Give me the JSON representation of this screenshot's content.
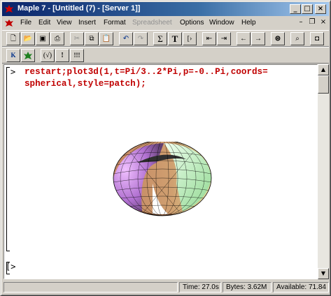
{
  "window": {
    "title": "Maple 7 - [Untitled (7) - [Server 1]]"
  },
  "menu": [
    {
      "label": "File",
      "disabled": false
    },
    {
      "label": "Edit",
      "disabled": false
    },
    {
      "label": "View",
      "disabled": false
    },
    {
      "label": "Insert",
      "disabled": false
    },
    {
      "label": "Format",
      "disabled": false
    },
    {
      "label": "Spreadsheet",
      "disabled": true
    },
    {
      "label": "Options",
      "disabled": false
    },
    {
      "label": "Window",
      "disabled": false
    },
    {
      "label": "Help",
      "disabled": false
    }
  ],
  "toolbar2": {
    "k_label": "K",
    "sqrt_label": "(√)",
    "excl_label": "!",
    "excl3_label": "!!!"
  },
  "worksheet": {
    "prompt1": ">",
    "line1": "restart;plot3d(1,t=Pi/3..2*Pi,p=-0..Pi,coords=",
    "line2": "spherical,style=patch);",
    "prompt2": "[>"
  },
  "status": {
    "time": "Time: 27.0s",
    "bytes": "Bytes: 3.62M",
    "available": "Available: 71.84"
  },
  "colors": {
    "title_start": "#0a246a",
    "command_red": "#c00000"
  }
}
